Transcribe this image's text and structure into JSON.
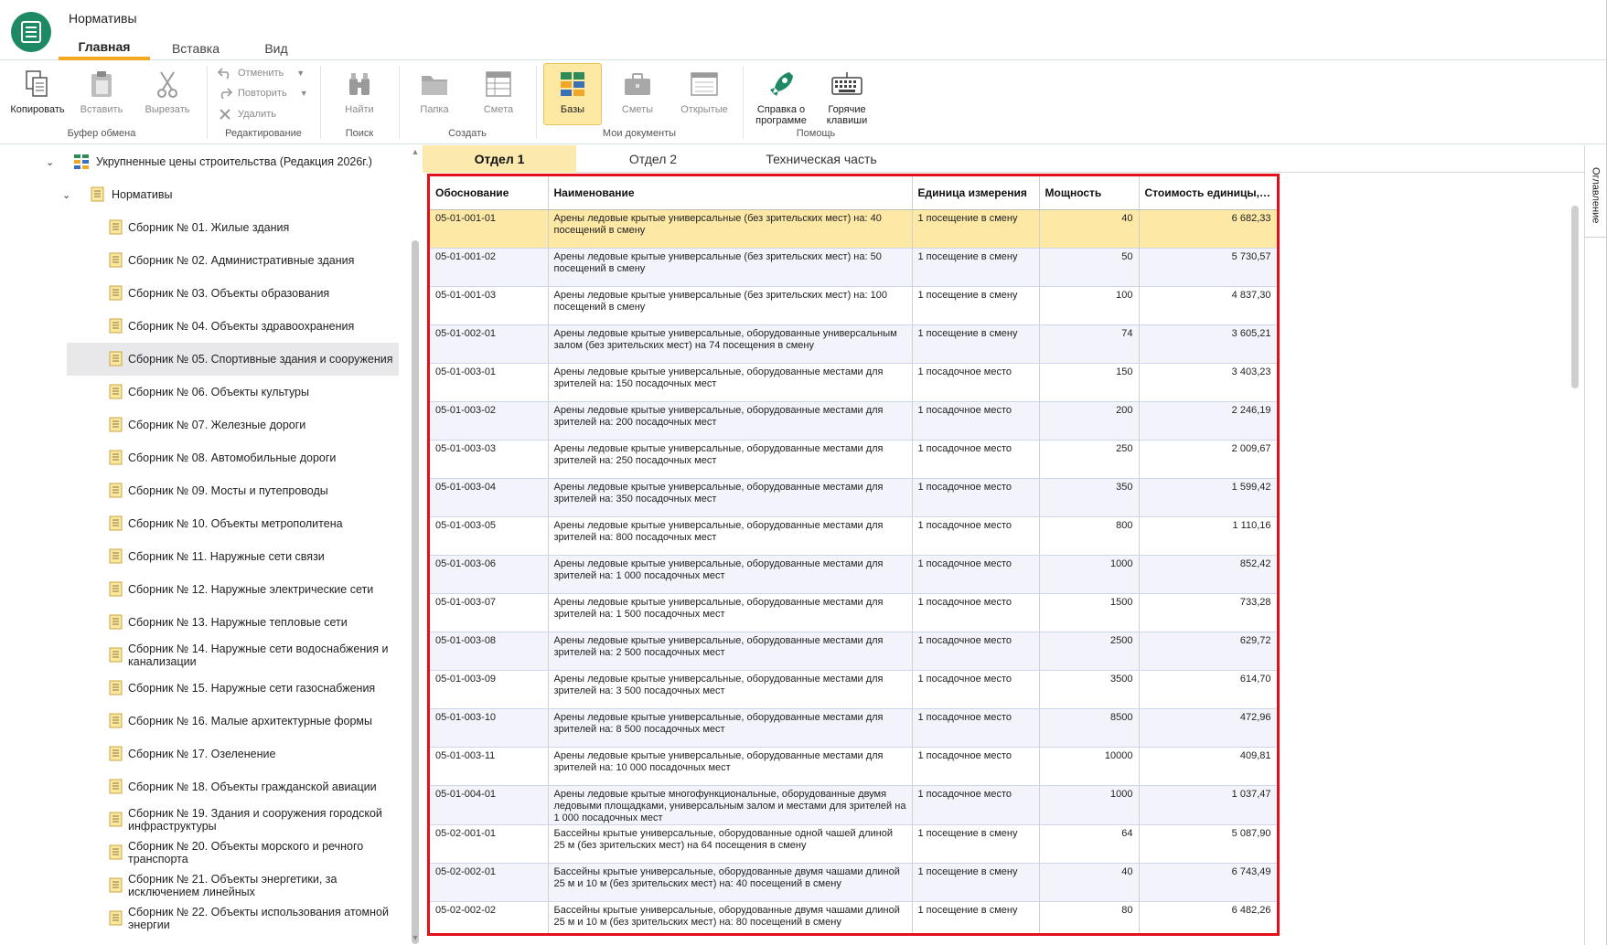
{
  "app": {
    "title": "Нормативы",
    "tabs": [
      {
        "label": "Главная",
        "active": true
      },
      {
        "label": "Вставка",
        "active": false
      },
      {
        "label": "Вид",
        "active": false
      }
    ],
    "accent_color": "#f5a623",
    "logo_color": "#1e8a63"
  },
  "ribbon": {
    "copy": "Копировать",
    "paste": "Вставить",
    "cut": "Вырезать",
    "undo": "Отменить",
    "redo": "Повторить",
    "delete": "Удалить",
    "find": "Найти",
    "folder": "Папка",
    "estimate": "Смета",
    "bases": "Базы",
    "estimates": "Сметы",
    "opened": "Открытые",
    "about": "Справка о программе",
    "hotkeys": "Горячие клавиши",
    "groups": {
      "clipboard": "Буфер обмена",
      "editing": "Редактирование",
      "search": "Поиск",
      "create": "Создать",
      "my_docs": "Мои документы",
      "help": "Помощь"
    }
  },
  "tree": {
    "root": "Укрупненные цены строительства (Редакция 2026г.)",
    "folder": "Нормативы",
    "items": [
      {
        "label": "Сборник № 01. Жилые здания"
      },
      {
        "label": "Сборник № 02. Административные здания"
      },
      {
        "label": "Сборник № 03. Объекты образования"
      },
      {
        "label": "Сборник № 04. Объекты здравоохранения"
      },
      {
        "label": "Сборник № 05. Спортивные здания и сооружения",
        "selected": true
      },
      {
        "label": "Сборник № 06. Объекты культуры"
      },
      {
        "label": "Сборник № 07. Железные дороги"
      },
      {
        "label": "Сборник № 08. Автомобильные дороги"
      },
      {
        "label": "Сборник № 09. Мосты и путепроводы"
      },
      {
        "label": "Сборник № 10. Объекты метрополитена"
      },
      {
        "label": "Сборник № 11. Наружные сети связи"
      },
      {
        "label": "Сборник № 12. Наружные электрические сети"
      },
      {
        "label": "Сборник № 13. Наружные тепловые сети"
      },
      {
        "label": "Сборник № 14. Наружные сети водоснабжения и канализации"
      },
      {
        "label": "Сборник № 15. Наружные сети газоснабжения"
      },
      {
        "label": "Сборник № 16. Малые архитектурные формы"
      },
      {
        "label": "Сборник № 17. Озеленение"
      },
      {
        "label": "Сборник № 18. Объекты гражданской авиации"
      },
      {
        "label": "Сборник № 19. Здания и сооружения городской инфраструктуры"
      },
      {
        "label": "Сборник № 20. Объекты морского и речного транспорта"
      },
      {
        "label": "Сборник № 21. Объекты энергетики, за исключением линейных"
      },
      {
        "label": "Сборник № 22. Объекты использования атомной энергии"
      }
    ]
  },
  "content_tabs": [
    {
      "label": "Отдел 1",
      "active": true
    },
    {
      "label": "Отдел 2",
      "active": false
    },
    {
      "label": "Техническая часть",
      "active": false
    }
  ],
  "table": {
    "columns": [
      "Обоснование",
      "Наименование",
      "Единица измерения",
      "Мощность",
      "Стоимость единицы, ты..."
    ],
    "rows": [
      {
        "code": "05-01-001-01",
        "name": "Арены ледовые крытые универсальные (без зрительских мест) на: 40 посещений в смену",
        "unit": "1 посещение в смену",
        "capacity": "40",
        "cost": "6 682,33",
        "selected": true
      },
      {
        "code": "05-01-001-02",
        "name": "Арены ледовые крытые универсальные (без зрительских мест) на: 50 посещений в смену",
        "unit": "1 посещение в смену",
        "capacity": "50",
        "cost": "5 730,57"
      },
      {
        "code": "05-01-001-03",
        "name": "Арены ледовые крытые универсальные (без зрительских мест) на: 100 посещений в смену",
        "unit": "1 посещение в смену",
        "capacity": "100",
        "cost": "4 837,30"
      },
      {
        "code": "05-01-002-01",
        "name": "Арены ледовые крытые универсальные, оборудованные универсальным залом (без зрительских мест) на 74 посещения в смену",
        "unit": "1 посещение в смену",
        "capacity": "74",
        "cost": "3 605,21"
      },
      {
        "code": "05-01-003-01",
        "name": "Арены ледовые крытые универсальные, оборудованные местами для зрителей на: 150 посадочных мест",
        "unit": "1 посадочное место",
        "capacity": "150",
        "cost": "3 403,23"
      },
      {
        "code": "05-01-003-02",
        "name": "Арены ледовые крытые универсальные, оборудованные местами для зрителей на: 200 посадочных мест",
        "unit": "1 посадочное место",
        "capacity": "200",
        "cost": "2 246,19"
      },
      {
        "code": "05-01-003-03",
        "name": "Арены ледовые крытые универсальные, оборудованные местами для зрителей на: 250 посадочных мест",
        "unit": "1 посадочное место",
        "capacity": "250",
        "cost": "2 009,67"
      },
      {
        "code": "05-01-003-04",
        "name": "Арены ледовые крытые универсальные, оборудованные местами для зрителей на: 350 посадочных мест",
        "unit": "1 посадочное место",
        "capacity": "350",
        "cost": "1 599,42"
      },
      {
        "code": "05-01-003-05",
        "name": "Арены ледовые крытые универсальные, оборудованные местами для зрителей на: 800 посадочных мест",
        "unit": "1 посадочное место",
        "capacity": "800",
        "cost": "1 110,16"
      },
      {
        "code": "05-01-003-06",
        "name": "Арены ледовые крытые универсальные, оборудованные местами для зрителей на: 1 000 посадочных мест",
        "unit": "1 посадочное место",
        "capacity": "1000",
        "cost": "852,42"
      },
      {
        "code": "05-01-003-07",
        "name": "Арены ледовые крытые универсальные, оборудованные местами для зрителей на: 1 500 посадочных мест",
        "unit": "1 посадочное место",
        "capacity": "1500",
        "cost": "733,28"
      },
      {
        "code": "05-01-003-08",
        "name": "Арены ледовые крытые универсальные, оборудованные местами для зрителей на: 2 500 посадочных мест",
        "unit": "1 посадочное место",
        "capacity": "2500",
        "cost": "629,72"
      },
      {
        "code": "05-01-003-09",
        "name": "Арены ледовые крытые универсальные, оборудованные местами для зрителей на: 3 500 посадочных мест",
        "unit": "1 посадочное место",
        "capacity": "3500",
        "cost": "614,70"
      },
      {
        "code": "05-01-003-10",
        "name": "Арены ледовые крытые универсальные, оборудованные местами для зрителей на: 8 500 посадочных мест",
        "unit": "1 посадочное место",
        "capacity": "8500",
        "cost": "472,96"
      },
      {
        "code": "05-01-003-11",
        "name": "Арены ледовые крытые универсальные, оборудованные местами для зрителей на: 10 000 посадочных мест",
        "unit": "1 посадочное место",
        "capacity": "10000",
        "cost": "409,81"
      },
      {
        "code": "05-01-004-01",
        "name": "Арены ледовые крытые многофункциональные, оборудованные двумя ледовыми площадками, универсальным залом и местами для зрителей на 1 000 посадочных мест",
        "unit": "1 посадочное место",
        "capacity": "1000",
        "cost": "1 037,47"
      },
      {
        "code": "05-02-001-01",
        "name": "Бассейны крытые универсальные, оборудованные одной чашей длиной 25 м (без зрительских мест) на 64 посещения в смену",
        "unit": "1 посещение в смену",
        "capacity": "64",
        "cost": "5 087,90"
      },
      {
        "code": "05-02-002-01",
        "name": "Бассейны крытые универсальные, оборудованные двумя чашами длиной 25 м и 10 м (без зрительских мест) на: 40 посещений в смену",
        "unit": "1 посещение в смену",
        "capacity": "40",
        "cost": "6 743,49"
      },
      {
        "code": "05-02-002-02",
        "name": "Бассейны крытые универсальные, оборудованные двумя чашами длиной 25 м и 10 м (без зрительских мест) на: 80 посещений в смену",
        "unit": "1 посещение в смену",
        "capacity": "80",
        "cost": "6 482,26"
      }
    ]
  },
  "right_rail": {
    "toc": "Оглавление"
  },
  "colors": {
    "highlight_border": "#e3101c",
    "selected_row": "#fde8a6",
    "active_tab": "#fbe9ad"
  }
}
